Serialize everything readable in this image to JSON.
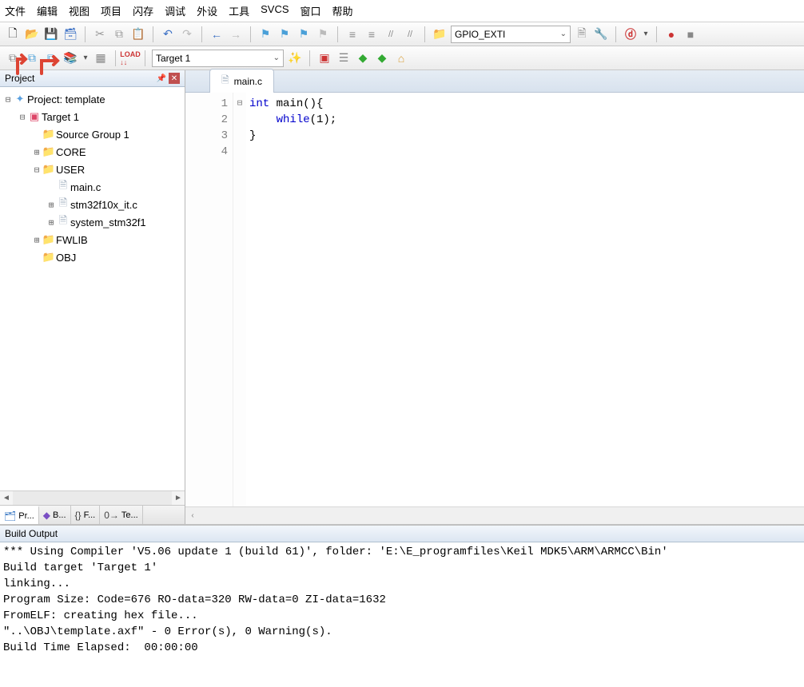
{
  "menu": [
    "文件",
    "编辑",
    "视图",
    "项目",
    "闪存",
    "调试",
    "外设",
    "工具",
    "SVCS",
    "窗口",
    "帮助"
  ],
  "toolbar1": {
    "project_name": "GPIO_EXTI",
    "icons": {
      "new": "🗋",
      "open": "📂",
      "save": "💾",
      "saveall": "🗃",
      "cut": "✂",
      "copy": "⧉",
      "paste": "📋",
      "undo": "↶",
      "redo": "↷",
      "back": "←",
      "fwd": "→",
      "bookmark": "⚑",
      "bm2": "⚑",
      "bm3": "⚑",
      "bm4": "⚑",
      "indent": "≡",
      "outdent": "≡",
      "c1": "//",
      "c2": "//",
      "folder": "📁",
      "opts": "🗎",
      "cfg": "🔧",
      "find": "🔍",
      "dd": "▾",
      "rec": "●",
      "stop": "■"
    }
  },
  "toolbar2": {
    "target": "Target 1",
    "icons": {
      "b1": "⧉",
      "b2": "⧉",
      "b3": "⧉",
      "layers": "📚",
      "dd": "▾",
      "grid": "▦",
      "load": "LOAD",
      "wand": "✨",
      "red": "■",
      "stack": "☰",
      "g1": "◆",
      "g2": "◆",
      "home": "⌂"
    }
  },
  "project_panel": {
    "title": "Project",
    "root": "Project: template",
    "target": "Target 1",
    "groups": [
      {
        "name": "Source Group 1",
        "exp": null,
        "children": []
      },
      {
        "name": "CORE",
        "exp": false,
        "children": []
      },
      {
        "name": "USER",
        "exp": true,
        "children": [
          {
            "name": "main.c",
            "exp": null
          },
          {
            "name": "stm32f10x_it.c",
            "exp": false
          },
          {
            "name": "system_stm32f1",
            "exp": false
          }
        ]
      },
      {
        "name": "FWLIB",
        "exp": false,
        "children": []
      },
      {
        "name": "OBJ",
        "exp": null,
        "children": []
      }
    ],
    "bottom_tabs": [
      {
        "label": "Pr...",
        "icon": "🗂",
        "color": "#3a78c4",
        "active": true
      },
      {
        "label": "B...",
        "icon": "◆",
        "color": "#7a4fc4",
        "active": false
      },
      {
        "label": "F...",
        "icon": "{}",
        "color": "#444",
        "active": false
      },
      {
        "label": "Te...",
        "icon": "0→",
        "color": "#444",
        "active": false
      }
    ]
  },
  "editor": {
    "active_tab": "main.c",
    "lines": [
      {
        "n": 1,
        "fold": "⊟",
        "tokens": [
          {
            "t": "int",
            "k": true
          },
          {
            "t": " main(){"
          }
        ]
      },
      {
        "n": 2,
        "fold": "",
        "tokens": [
          {
            "t": "    "
          },
          {
            "t": "while",
            "k": true
          },
          {
            "t": "(1);"
          }
        ]
      },
      {
        "n": 3,
        "fold": "",
        "tokens": [
          {
            "t": ""
          }
        ]
      },
      {
        "n": 4,
        "fold": "",
        "tokens": [
          {
            "t": "}"
          }
        ]
      }
    ]
  },
  "build": {
    "title": "Build Output",
    "lines": [
      "*** Using Compiler 'V5.06 update 1 (build 61)', folder: 'E:\\E_programfiles\\Keil MDK5\\ARM\\ARMCC\\Bin'",
      "Build target 'Target 1'",
      "linking...",
      "Program Size: Code=676 RO-data=320 RW-data=0 ZI-data=1632",
      "FromELF: creating hex file...",
      "\"..\\OBJ\\template.axf\" - 0 Error(s), 0 Warning(s).",
      "Build Time Elapsed:  00:00:00"
    ]
  }
}
